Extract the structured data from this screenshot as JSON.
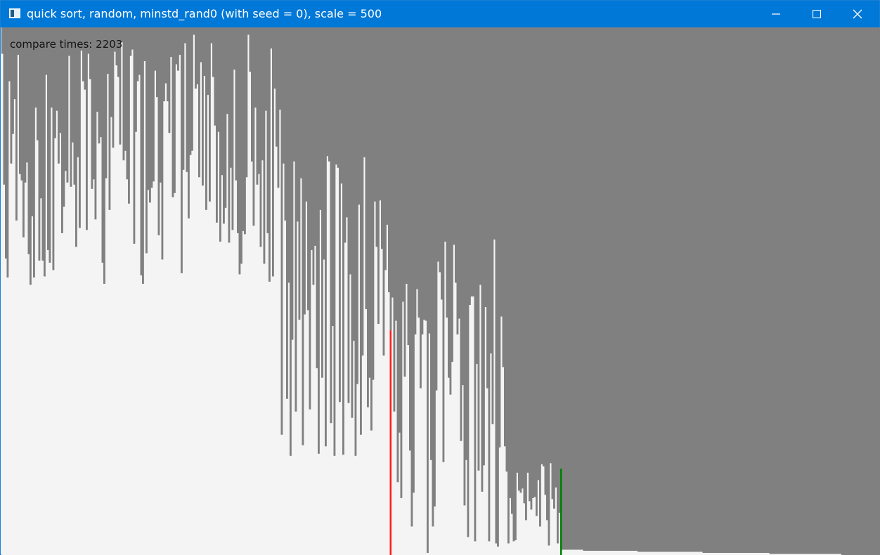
{
  "window": {
    "title": "quick sort, random, minstd_rand0 (with seed = 0), scale = 500",
    "icon": "app-window-icon",
    "controls": [
      "minimize-icon",
      "maximize-icon",
      "close-icon"
    ]
  },
  "status": {
    "compare_label": "compare times:",
    "compare_count": "2203",
    "compare_text": "compare times: 2203"
  },
  "colors": {
    "titlebar": "#0078d7",
    "bar": "#808080",
    "background": "#f4f4f4",
    "pivot_marker": "#ff1a1a",
    "scan_marker": "#008000"
  },
  "chart_data": {
    "type": "bar",
    "bar_count": 500,
    "ylim": [
      0,
      500
    ],
    "segments": [
      {
        "from": 0,
        "to": 158,
        "min": 5,
        "max": 245
      },
      {
        "from": 159,
        "to": 221,
        "min": 112,
        "max": 411
      },
      {
        "from": 222,
        "to": 287,
        "min": 201,
        "max": 500
      },
      {
        "from": 288,
        "to": 317,
        "min": 412,
        "max": 494
      }
    ],
    "sorted_from": 318,
    "sorted_start_value": 495,
    "highlights": [
      {
        "name": "pivot",
        "index": 221,
        "value": 287
      },
      {
        "name": "scan",
        "index": 318,
        "value": 418
      }
    ]
  }
}
